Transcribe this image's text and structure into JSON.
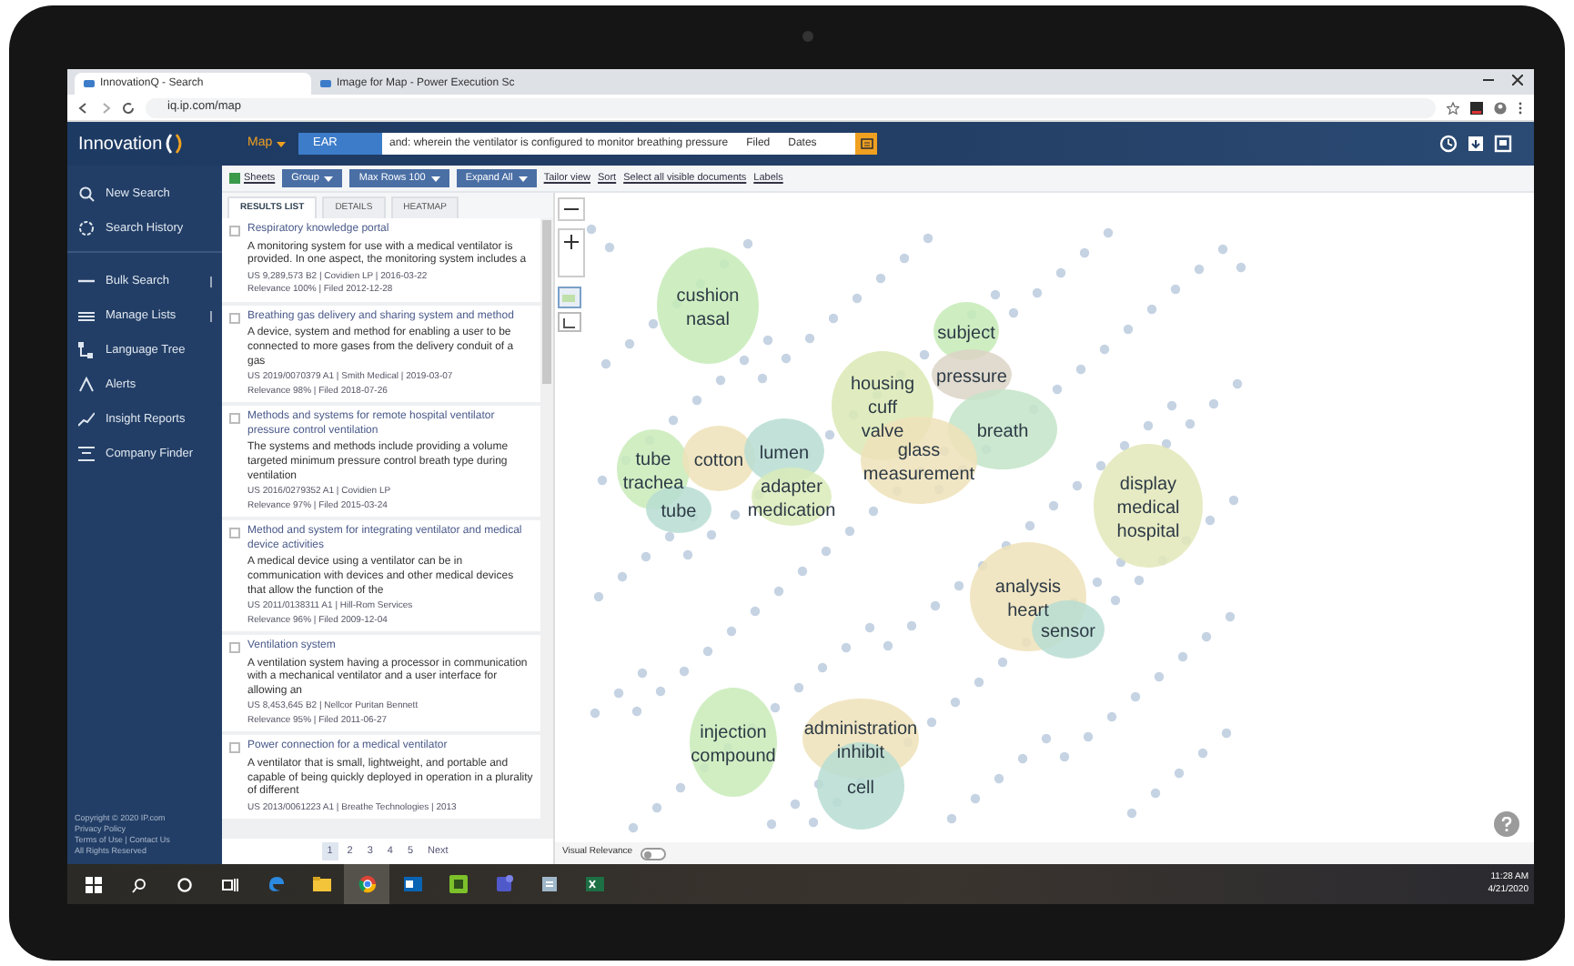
{
  "browser": {
    "tabs": [
      {
        "title": "InnovationQ - Search",
        "selected": true
      },
      {
        "title": "Image for Map - Power Execution Sc",
        "selected": false
      }
    ],
    "url": "iq.ip.com/map"
  },
  "app": {
    "logo": "Innovation",
    "mode": "Map",
    "field": "EAR",
    "query": "and: wherein the ventilator is configured to monitor breathing pressure",
    "date_from": "Filed",
    "date_to": "Dates"
  },
  "sidebar": {
    "items": [
      {
        "label": "New Search",
        "kind": "link"
      },
      {
        "label": "Search History",
        "kind": "link"
      },
      {
        "label": "Bulk Search",
        "kind": "expandable"
      },
      {
        "label": "Manage Lists",
        "kind": "expandable"
      },
      {
        "label": "Language Tree",
        "kind": "link"
      },
      {
        "label": "Alerts",
        "kind": "link"
      },
      {
        "label": "Insight Reports",
        "kind": "link"
      },
      {
        "label": "Company Finder",
        "kind": "link"
      }
    ],
    "footer": [
      "Copyright © 2020 IP.com",
      "Privacy Policy",
      "Terms of Use | Contact Us",
      "All Rights Reserved"
    ]
  },
  "toolbar": {
    "sheet": "Sheets",
    "buttons": [
      "Group",
      "Max Rows 100",
      "Expand All"
    ],
    "tools": [
      "Tailor view",
      "Sort",
      "Select all visible documents",
      "Labels"
    ]
  },
  "results": {
    "tabs": [
      {
        "label": "RESULTS LIST",
        "selected": true
      },
      {
        "label": "DETAILS",
        "selected": false
      },
      {
        "label": "HEATMAP",
        "selected": false
      }
    ],
    "items": [
      {
        "title": "Respiratory knowledge portal",
        "abstract": "A monitoring system for use with a medical ventilator is provided. In one aspect, the monitoring system includes a",
        "meta": [
          "US 9,289,573 B2 | Covidien LP | 2016-03-22",
          "Relevance 100% | Filed 2012-12-28"
        ],
        "checked": false
      },
      {
        "title": "Breathing gas delivery and sharing system and method",
        "abstract": "A device, system and method for enabling a user to be connected to more gases from the delivery conduit of a gas",
        "meta": [
          "US 2019/0070379 A1 | Smith Medical | 2019-03-07",
          "Relevance 98% | Filed 2018-07-26"
        ],
        "checked": false
      },
      {
        "title": "Methods and systems for remote hospital ventilator pressure control ventilation",
        "abstract": "The systems and methods include providing a volume targeted minimum pressure control breath type during ventilation",
        "meta": [
          "US 2016/0279352 A1 | Covidien LP",
          "Relevance 97% | Filed 2015-03-24"
        ],
        "checked": false
      },
      {
        "title": "Method and system for integrating ventilator and medical device activities",
        "abstract": "A medical device using a ventilator can be in communication with devices and other medical devices that allow the function of the",
        "meta": [
          "US 2011/0138311 A1 | Hill-Rom Services",
          "Relevance 96% | Filed 2009-12-04"
        ],
        "checked": false
      },
      {
        "title": "Ventilation system",
        "abstract": "A ventilation system having a processor in communication with a mechanical ventilator and a user interface for allowing an",
        "meta": [
          "US 8,453,645 B2 | Nellcor Puritan Bennett",
          "Relevance 95% | Filed 2011-06-27"
        ],
        "checked": false
      },
      {
        "title": "Power connection for a medical ventilator",
        "abstract": "A ventilator that is small, lightweight, and portable and capable of being quickly deployed in operation in a plurality of different",
        "meta": [
          "US 2013/0061223 A1 | Breathe Technologies | 2013"
        ],
        "checked": false
      }
    ],
    "pages": [
      {
        "label": "1",
        "selected": true
      },
      {
        "label": "2",
        "selected": false
      },
      {
        "label": "3",
        "selected": false
      },
      {
        "label": "4",
        "selected": false
      },
      {
        "label": "5",
        "selected": false
      },
      {
        "label": "Next",
        "selected": false
      }
    ]
  },
  "map": {
    "clusters": [
      {
        "color": "#c6ebb6",
        "words": [
          "cushion",
          "nasal"
        ]
      },
      {
        "color": "#c6ebb6",
        "words": [
          "subject"
        ]
      },
      {
        "color": "#dcd4c6",
        "words": [
          "pressure"
        ]
      },
      {
        "color": "#dbe9b4",
        "words": [
          "housing",
          "cuff",
          "valve"
        ]
      },
      {
        "color": "#c3e4c8",
        "words": [
          "breath"
        ]
      },
      {
        "color": "#c9ebb8",
        "words": [
          "tube",
          "trachea"
        ]
      },
      {
        "color": "#eee2b8",
        "words": [
          "cotton"
        ]
      },
      {
        "color": "#b7ddd2",
        "words": [
          "tube"
        ]
      },
      {
        "color": "#b7ddd2",
        "words": [
          "lumen"
        ]
      },
      {
        "color": "#eee2b8",
        "words": [
          "glass",
          "measurement"
        ]
      },
      {
        "color": "#d9ebb8",
        "words": [
          "adapter",
          "medication"
        ]
      },
      {
        "color": "#e3e8b8",
        "words": [
          "display",
          "medical",
          "hospital"
        ]
      },
      {
        "color": "#eee2b8",
        "words": [
          "analysis",
          "heart"
        ]
      },
      {
        "color": "#b7ddd2",
        "words": [
          "sensor"
        ]
      },
      {
        "color": "#c9ebb8",
        "words": [
          "injection",
          "compound"
        ]
      },
      {
        "color": "#eee2b8",
        "words": [
          "administration",
          "inhibit"
        ]
      },
      {
        "color": "#b7ddd2",
        "words": [
          "cell"
        ]
      }
    ],
    "relevance": {
      "label": "Visual Relevance",
      "on": false
    }
  },
  "taskbar": {
    "apps": [
      {
        "kind": "edge",
        "selected": false
      },
      {
        "kind": "folder",
        "selected": false
      },
      {
        "kind": "chrome",
        "selected": true
      },
      {
        "kind": "outlook",
        "selected": false
      },
      {
        "kind": "camtasia",
        "selected": false
      },
      {
        "kind": "teams",
        "selected": false
      },
      {
        "kind": "notes",
        "selected": false
      },
      {
        "kind": "excel",
        "selected": false
      }
    ],
    "clock": [
      "11:28 AM",
      "4/21/2020"
    ]
  }
}
